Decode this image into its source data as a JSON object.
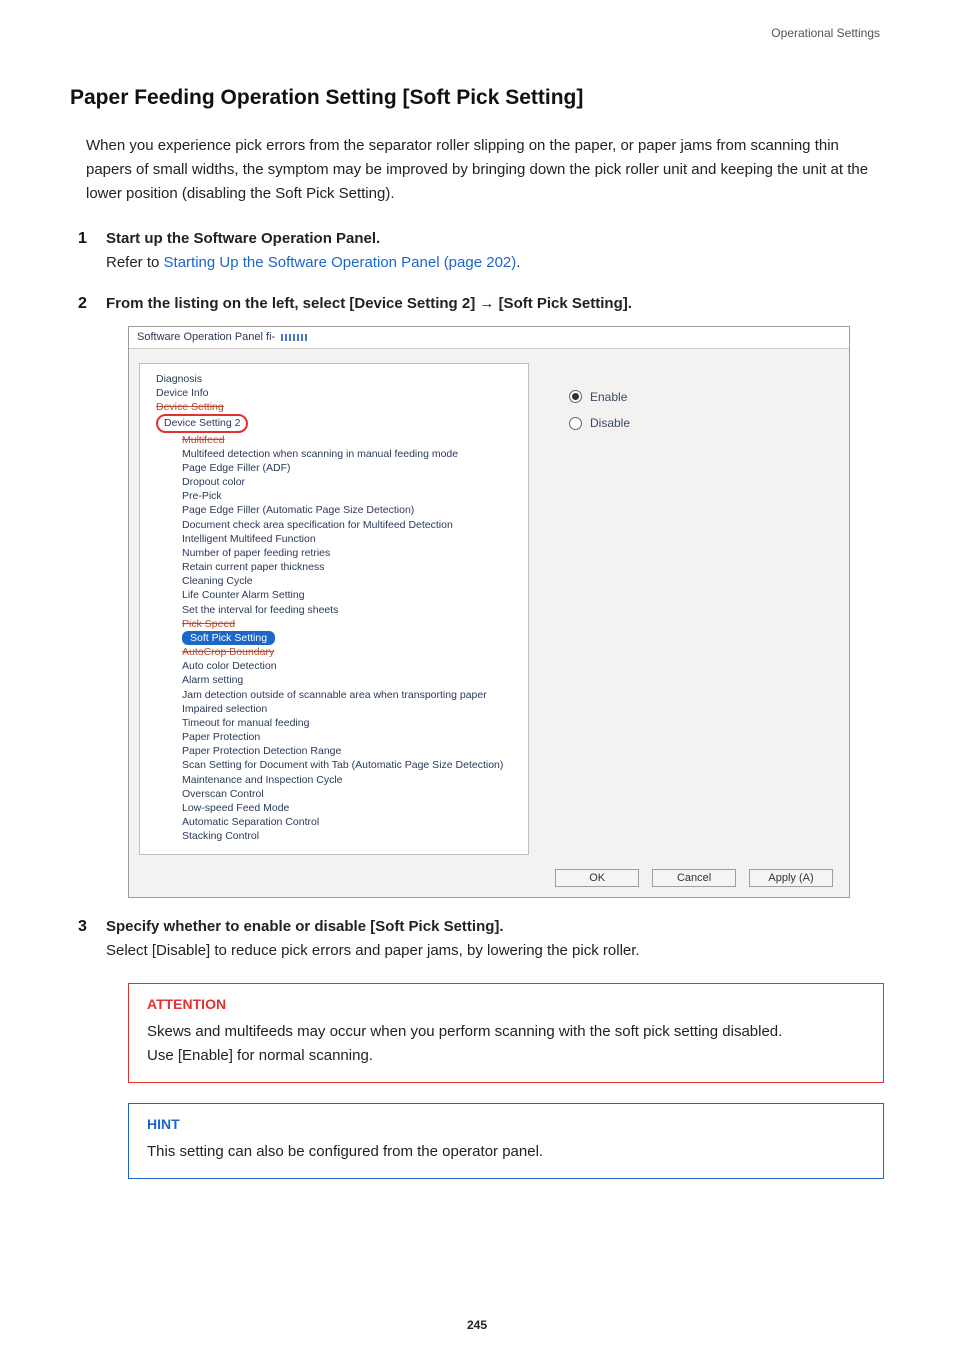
{
  "header": {
    "right_label": "Operational Settings"
  },
  "title": "Paper Feeding Operation Setting [Soft Pick Setting]",
  "intro": "When you experience pick errors from the separator roller slipping on the paper, or paper jams from scanning thin papers of small widths, the symptom may be improved by bringing down the pick roller unit and keeping the unit at the lower position (disabling the Soft Pick Setting).",
  "steps": [
    {
      "num": "1",
      "title": "Start up the Software Operation Panel.",
      "body_prefix": "Refer to ",
      "link_text": "Starting Up the Software Operation Panel (page 202)",
      "body_suffix": "."
    },
    {
      "num": "2",
      "title": "From the listing on the left, select [Device Setting 2] → [Soft Pick Setting]."
    },
    {
      "num": "3",
      "title": "Specify whether to enable or disable [Soft Pick Setting].",
      "body": "Select [Disable] to reduce pick errors and paper jams, by lowering the pick roller."
    }
  ],
  "dialog": {
    "window_title": "Software Operation Panel fi-",
    "tree": {
      "top": [
        "Diagnosis",
        "Device Info",
        "Device Setting"
      ],
      "group_label": "Device Setting 2",
      "children": [
        "Multifeed",
        "Multifeed detection when scanning in manual feeding mode",
        "Page Edge Filler (ADF)",
        "Dropout color",
        "Pre-Pick",
        "Page Edge Filler (Automatic Page Size Detection)",
        "Document check area specification for Multifeed Detection",
        "Intelligent Multifeed Function",
        "Number of paper feeding retries",
        "Retain current paper thickness",
        "Cleaning Cycle",
        "Life Counter Alarm Setting",
        "Set the interval for feeding sheets",
        "Pick Speed"
      ],
      "selected_label": "Soft Pick Setting",
      "after_selected": [
        "AutoCrop Boundary",
        "Auto color Detection",
        "Alarm setting",
        "Jam detection outside of scannable area when transporting paper",
        "Impaired selection",
        "Timeout for manual feeding",
        "Paper Protection",
        "Paper Protection Detection Range",
        "Scan Setting for Document with Tab (Automatic Page Size Detection)",
        "Maintenance and Inspection Cycle",
        "Overscan Control",
        "Low-speed Feed Mode",
        "Automatic Separation Control",
        "Stacking Control"
      ]
    },
    "options": {
      "enable_label": "Enable",
      "disable_label": "Disable",
      "selected": "enable"
    },
    "buttons": {
      "ok": "OK",
      "cancel": "Cancel",
      "apply": "Apply (A)"
    }
  },
  "attention": {
    "heading": "ATTENTION",
    "line1": "Skews and multifeeds may occur when you perform scanning with the soft pick setting disabled.",
    "line2": "Use [Enable] for normal scanning."
  },
  "hint": {
    "heading": "HINT",
    "body": "This setting can also be configured from the operator panel."
  },
  "page_number": "245"
}
